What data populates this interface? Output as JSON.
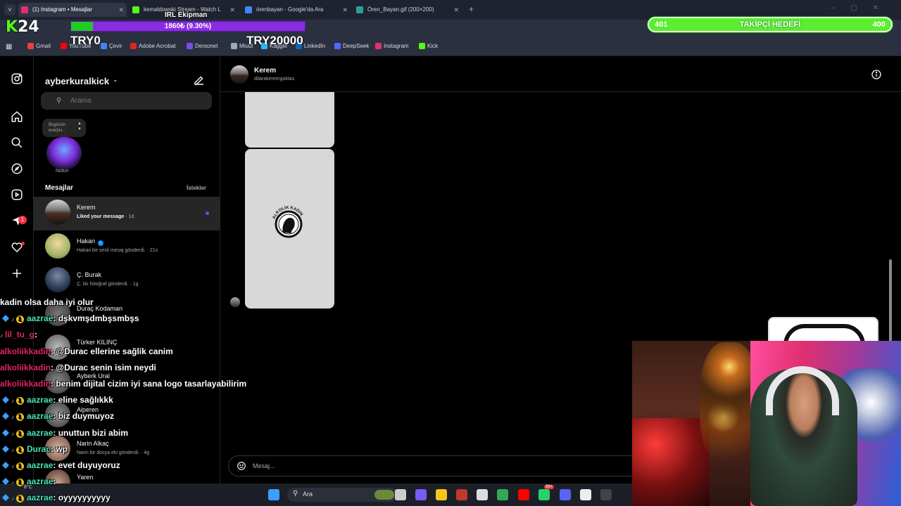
{
  "browser": {
    "tabs": [
      {
        "title": "(1) Instagram • Mesajlar",
        "color": "#e1306c"
      },
      {
        "title": "kemaldowski Stream - Watch L",
        "color": "#53fc18"
      },
      {
        "title": "örenbayan - Google'da Ara",
        "color": "#4285f4"
      },
      {
        "title": "Ören_Bayan.gif (200×200)",
        "color": "#2aa198"
      }
    ],
    "bookmarks": [
      {
        "label": "Gmail",
        "color": "#ea4335"
      },
      {
        "label": "YouTube",
        "color": "#ff0000"
      },
      {
        "label": "Çevir",
        "color": "#4285f4"
      },
      {
        "label": "Adobe Acrobat",
        "color": "#e0261b"
      },
      {
        "label": "Dersonet",
        "color": "#7b4de0"
      },
      {
        "label": "Miuul",
        "color": "#9ab"
      },
      {
        "label": "Kaggle",
        "color": "#20beff"
      },
      {
        "label": "LinkedIn",
        "color": "#0a66c2"
      },
      {
        "label": "DeepSeek",
        "color": "#4d6bfe"
      },
      {
        "label": "Instagram",
        "color": "#e1306c"
      },
      {
        "label": "Kick",
        "color": "#53fc18"
      }
    ]
  },
  "overlay": {
    "k24_prefix": "K",
    "k24_suffix": "24",
    "irl_label": "IRL Ekipman",
    "donation_text": "1860₺ (9.30%)",
    "donation_progress": 0.093,
    "try_left": "TRY0",
    "try_right": "TRY20000",
    "follower_current": "401",
    "follower_label": "TAKİPÇİ HEDEFİ",
    "follower_goal": "400"
  },
  "instagram": {
    "account": "ayberkuralkick",
    "search_placeholder": "Arama",
    "note_text": "Bugünün enerjisi...",
    "note_label": "Notun",
    "messages_header": "Mesajlar",
    "requests_header": "İstekler",
    "unread_badge": "1",
    "conversations": [
      {
        "name": "Kerem",
        "preview": "Liked your message",
        "time": "1d",
        "unread": true,
        "avatar": "linear-gradient(180deg,#d6d6d6 0%,#7a7a7a 40%,#4a2e20 55%,#141414 100%)"
      },
      {
        "name": "Hakan",
        "verified": true,
        "preview": "Hakan bir sesli mesaj gönderdi.",
        "time": "21s",
        "avatar": "radial-gradient(circle at 50% 40%,#f0d7a0,#a6b36a 60%,#586b2e)"
      },
      {
        "name": "Ç. Burak",
        "preview": "Ç. bir fotoğraf gönderdi.",
        "time": "1g",
        "avatar": "radial-gradient(circle at 50% 35%,#7a8aa0,#2a3a55 60%,#0e1420)"
      },
      {
        "name": "Duraç Kodaman",
        "preview": "",
        "time": "1g",
        "avatar": "radial-gradient(circle,#777,#333)"
      },
      {
        "name": "Türker KILINÇ",
        "preview": "",
        "time": "",
        "avatar": "radial-gradient(circle,#bbb,#555)"
      },
      {
        "name": "Ayberk Ural",
        "preview": "",
        "time": "",
        "avatar": "radial-gradient(circle,#888,#333)"
      },
      {
        "name": "Alperen",
        "preview": "",
        "time": "",
        "avatar": "radial-gradient(circle,#999,#333)"
      },
      {
        "name": "Narin Alkaç",
        "preview": "Narin bir dosya eki gönderdi.",
        "time": "4g",
        "avatar": "radial-gradient(circle,#d8b0a0,#6a4a3a)"
      },
      {
        "name": "Yaren",
        "preview": "",
        "time": "",
        "avatar": "radial-gradient(circle,#c8a090,#4a3028)"
      }
    ],
    "chat": {
      "name": "Kerem",
      "handle": "dilarakeremgoktas",
      "logo_text": "ALKOLİK KADIN",
      "composer_placeholder": "Mesaj..."
    }
  },
  "stream_chat": [
    {
      "user": "",
      "text": "kadin olsa daha iyi olur",
      "user_color": "#ffffff"
    },
    {
      "user": "aazrae",
      "text": ": dşkvmşdmbşsmbşs",
      "user_color": "#4ae3b5",
      "badges": true
    },
    {
      "user": "lil_tu_g",
      "text": ":",
      "user_color": "#e0245e",
      "arrow": true
    },
    {
      "user": "alkoliikkadin",
      "text": ": @Durac ellerine sağlik canim",
      "user_color": "#e0245e"
    },
    {
      "user": "alkoliikkadin",
      "text": ": @Durac senin isim neydi",
      "user_color": "#e0245e"
    },
    {
      "user": "alkoliikkadin",
      "text": ": benim dijital cizim iyi sana logo tasarlayabilirim",
      "user_color": "#e0245e"
    },
    {
      "user": "aazrae",
      "text": ": eline sağlıkkk",
      "user_color": "#4ae3b5",
      "badges": true
    },
    {
      "user": "aazrae",
      "text": ": biz duymuyoz",
      "user_color": "#4ae3b5",
      "badges": true
    },
    {
      "user": "aazrae",
      "text": ": unuttun bizi abim",
      "user_color": "#4ae3b5",
      "badges": true
    },
    {
      "user": "Durac",
      "text": ": wp",
      "user_color": "#4ae3b5",
      "badges": true
    },
    {
      "user": "aazrae",
      "text": ": evet duyuyoruz",
      "user_color": "#4ae3b5",
      "badges": true
    },
    {
      "user": "aazrae",
      "text": ":",
      "user_color": "#4ae3b5",
      "badges": true
    },
    {
      "user": "aazrae",
      "text": ": oyyyyyyyyyy",
      "user_color": "#4ae3b5",
      "badges": true
    }
  ],
  "taskbar": {
    "search_label": "Ara",
    "weather": "8°C",
    "apps": [
      {
        "name": "windows-start",
        "color": "#3aa0ff"
      },
      {
        "name": "task-view",
        "color": "#ccc"
      },
      {
        "name": "copilot",
        "color": "#7a5af5"
      },
      {
        "name": "file-explorer",
        "color": "#f5c518"
      },
      {
        "name": "voicemeeter",
        "color": "#c0392b"
      },
      {
        "name": "store",
        "color": "#ddd"
      },
      {
        "name": "chrome",
        "color": "#34a853"
      },
      {
        "name": "youtube",
        "color": "#ff0000"
      },
      {
        "name": "whatsapp",
        "color": "#25d366"
      },
      {
        "name": "discord",
        "color": "#5865f2"
      },
      {
        "name": "capcut",
        "color": "#eee"
      },
      {
        "name": "obs",
        "color": "#444"
      },
      {
        "name": "chatgpt",
        "color": "#10a37f"
      }
    ],
    "whatsapp_badge": "99+"
  }
}
